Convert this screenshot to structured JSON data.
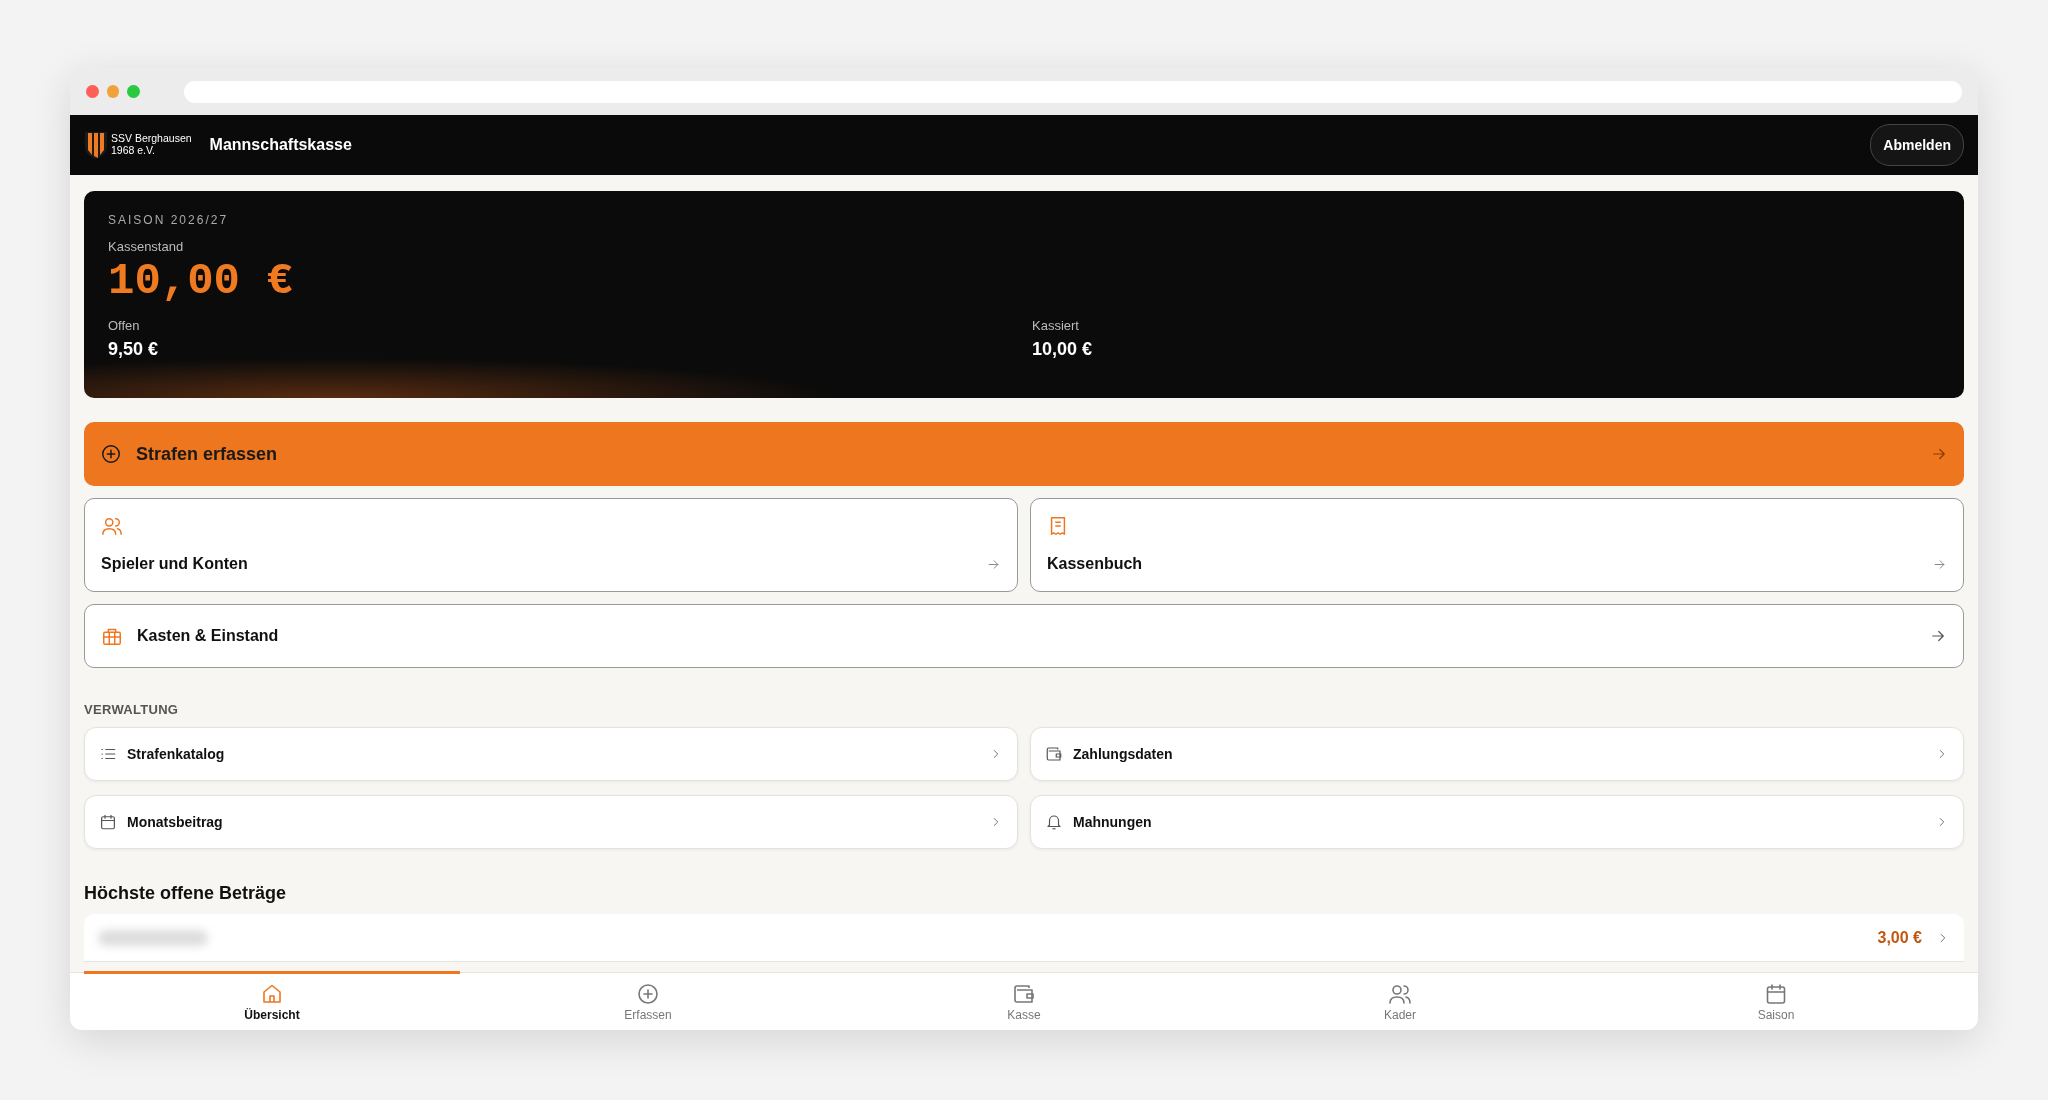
{
  "header": {
    "club_name": [
      "SSV Berghausen",
      "1968 e.V."
    ],
    "title": "Mannschaftskasse",
    "logout_button": "Abmelden"
  },
  "summary": {
    "season": "SAISON 2026/27",
    "balance_label": "Kassenstand",
    "balance": "10,00 €",
    "stats": [
      {
        "label": "Offen",
        "value": "9,50 €"
      },
      {
        "label": "Kassiert",
        "value": "10,00 €"
      }
    ]
  },
  "primary_action": "Strafen erfassen",
  "action_cards": [
    {
      "label": "Spieler und Konten"
    },
    {
      "label": "Kassenbuch"
    }
  ],
  "wide_card": "Kasten & Einstand",
  "admin": {
    "heading": "VERWALTUNG",
    "items": [
      {
        "label": "Strafenkatalog"
      },
      {
        "label": "Zahlungsdaten"
      },
      {
        "label": "Monatsbeitrag"
      },
      {
        "label": "Mahnungen"
      }
    ]
  },
  "top_open": {
    "heading": "Höchste offene Beträge",
    "rows": [
      {
        "amount": "3,00 €"
      }
    ]
  },
  "bottom_nav": [
    {
      "label": "Übersicht",
      "selected": true
    },
    {
      "label": "Erfassen",
      "selected": false
    },
    {
      "label": "Kasse",
      "selected": false
    },
    {
      "label": "Kader",
      "selected": false
    },
    {
      "label": "Saison",
      "selected": false
    }
  ]
}
